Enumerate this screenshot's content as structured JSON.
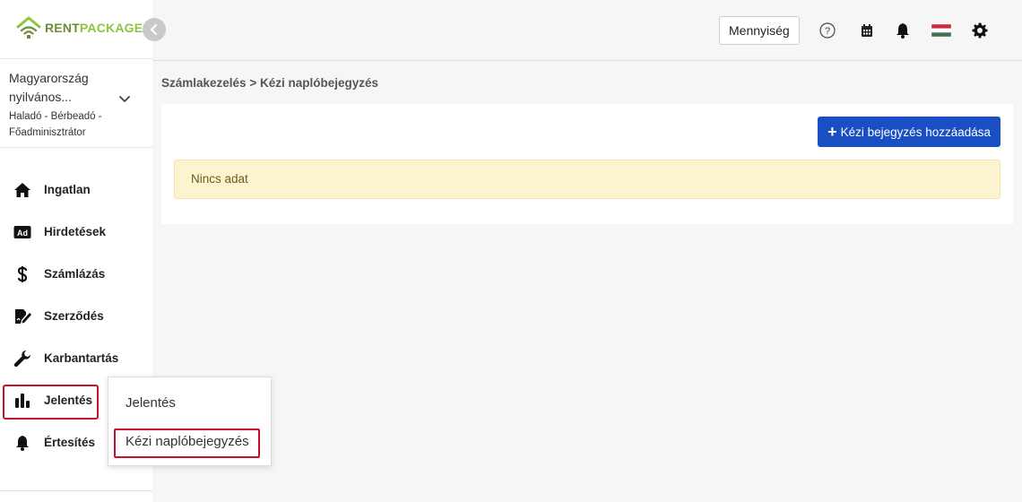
{
  "brand": {
    "part1": "RENT",
    "part2": "PACKAGE"
  },
  "account": {
    "name": "Magyarország nyilvános...",
    "role": "Haladó - Bérbeadó - Főadminisztrátor"
  },
  "nav": [
    {
      "label": "Ingatlan",
      "icon": "home-icon"
    },
    {
      "label": "Hirdetések",
      "icon": "ad-icon"
    },
    {
      "label": "Számlázás",
      "icon": "dollar-icon"
    },
    {
      "label": "Szerződés",
      "icon": "contract-icon"
    },
    {
      "label": "Karbantartás",
      "icon": "wrench-icon"
    },
    {
      "label": "Jelentés",
      "icon": "bar-chart-icon"
    },
    {
      "label": "Értesítés",
      "icon": "bell-icon"
    }
  ],
  "header": {
    "quantity_label": "Mennyiség",
    "icons": [
      "help-icon",
      "calendar-icon",
      "bell-icon",
      "flag-hu-icon",
      "gear-icon"
    ]
  },
  "breadcrumb": {
    "parent": "Számlakezelés",
    "separator": ">",
    "current": "Kézi naplóbejegyzés"
  },
  "main": {
    "add_button_label": "Kézi bejegyzés hozzáadása",
    "empty_message": "Nincs adat"
  },
  "dropdown": {
    "items": [
      "Jelentés",
      "Kézi naplóbejegyzés"
    ]
  },
  "colors": {
    "primary": "#1a4fc4",
    "highlight_outline": "#c8102e",
    "alert_bg": "#fcf3cf",
    "brand_green": "#8cc63f"
  }
}
